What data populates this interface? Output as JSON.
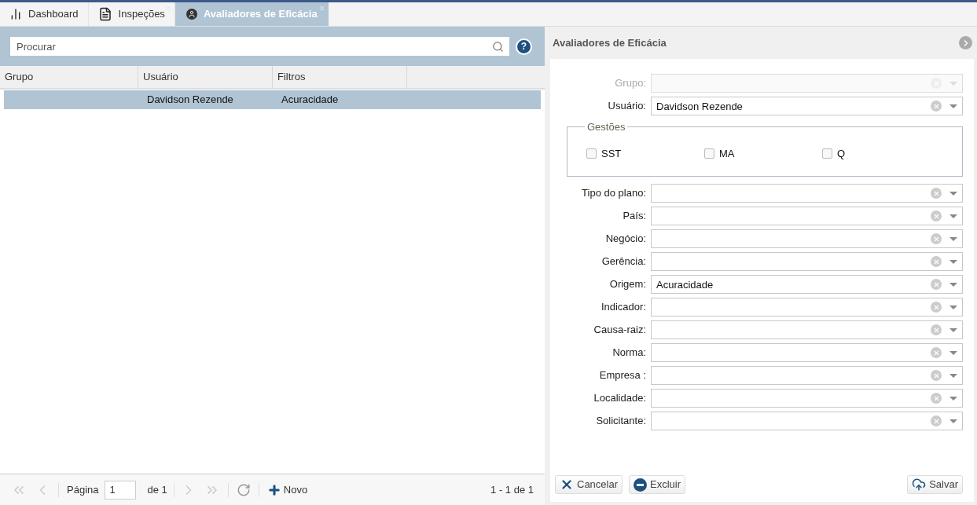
{
  "tabs": [
    {
      "label": "Dashboard",
      "selected": false,
      "closable": false
    },
    {
      "label": "Inspeções",
      "selected": false,
      "closable": true
    },
    {
      "label": "Avaliadores de Eficácia",
      "selected": true,
      "closable": true
    }
  ],
  "search": {
    "placeholder": "Procurar",
    "help": "?"
  },
  "table": {
    "columns": [
      "Grupo",
      "Usuário",
      "Filtros"
    ],
    "rows": [
      {
        "cells": [
          "",
          "Davidson Rezende",
          "Acuracidade"
        ],
        "selected": true
      }
    ]
  },
  "pager": {
    "page_label": "Página",
    "page": "1",
    "of": "de 1",
    "new_label": "Novo",
    "summary": "1 - 1 de 1"
  },
  "form": {
    "title": "Avaliadores de Eficácia",
    "top_fields": [
      {
        "label": "Grupo:",
        "disabled": true
      },
      {
        "label": "Usuário:",
        "value": "Davidson Rezende",
        "disabled": false
      }
    ],
    "group": {
      "legend": "Gestões",
      "options": [
        {
          "label": "SST",
          "checked": false
        },
        {
          "label": "MA",
          "checked": false
        },
        {
          "label": "Q",
          "checked": false
        }
      ]
    },
    "fields": [
      {
        "label": "Tipo do plano:",
        "disabled": false
      },
      {
        "label": "País:",
        "disabled": false
      },
      {
        "label": "Negócio:",
        "disabled": false
      },
      {
        "label": "Gerência:",
        "disabled": false
      },
      {
        "label": "Origem:",
        "value": "Acuracidade",
        "disabled": false
      },
      {
        "label": "Indicador:",
        "disabled": false
      },
      {
        "label": "Causa-raiz:",
        "disabled": false
      },
      {
        "label": "Norma:",
        "disabled": false
      },
      {
        "label": "Empresa :",
        "disabled": false
      },
      {
        "label": "Localidade:",
        "disabled": false
      },
      {
        "label": "Solicitante:",
        "disabled": false
      }
    ],
    "buttons": [
      {
        "label": "Cancelar",
        "kind": "cancel"
      },
      {
        "label": "Excluir",
        "kind": "delete"
      },
      {
        "label": "Salvar",
        "kind": "save"
      }
    ]
  }
}
